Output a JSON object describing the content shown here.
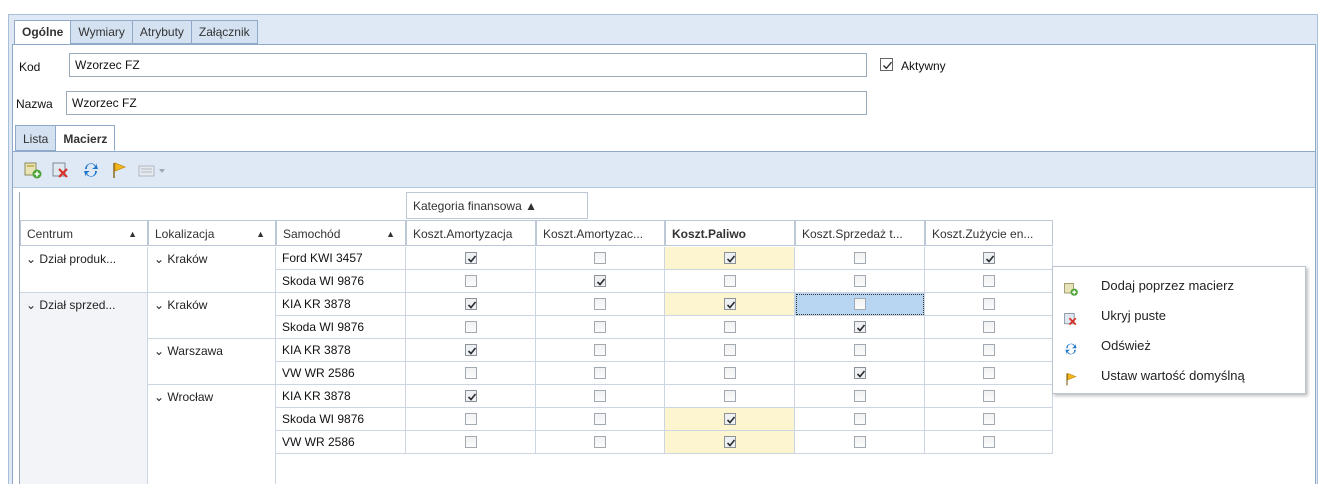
{
  "tabs": [
    {
      "label": "Ogólne",
      "active": true
    },
    {
      "label": "Wymiary"
    },
    {
      "label": "Atrybuty"
    },
    {
      "label": "Załącznik"
    }
  ],
  "form": {
    "kod_label": "Kod",
    "kod_value": "Wzorzec FZ",
    "nazwa_label": "Nazwa",
    "nazwa_value": "Wzorzec FZ",
    "aktywny_label": "Aktywny",
    "aktywny_checked": true
  },
  "subtabs": [
    {
      "label": "Lista"
    },
    {
      "label": "Macierz",
      "active": true
    }
  ],
  "toolbar": {
    "icons": [
      "add-matrix-icon",
      "hide-empty-icon",
      "refresh-icon",
      "flag-icon",
      "view-dropdown-icon"
    ]
  },
  "grid": {
    "group_header": "Kategoria finansowa",
    "row_headers": [
      "Centrum",
      "Lokalizacja",
      "Samochód"
    ],
    "columns": [
      "Koszt.Amortyzacja",
      "Koszt.Amortyzac...",
      "Koszt.Paliwo",
      "Koszt.Sprzedaż t...",
      "Koszt.Zużycie en..."
    ],
    "centrum_groups": [
      {
        "label": "Dział produk..."
      },
      {
        "label": "Dział sprzed..."
      }
    ],
    "lokalizacja_groups": [
      {
        "label": "Kraków"
      },
      {
        "label": "Kraków"
      },
      {
        "label": "Warszawa"
      },
      {
        "label": "Wrocław"
      }
    ],
    "rows": [
      {
        "samochod": "Ford KWI 3457",
        "checks": [
          true,
          false,
          true,
          false,
          true
        ]
      },
      {
        "samochod": "Skoda WI 9876",
        "checks": [
          false,
          true,
          false,
          false,
          false
        ]
      },
      {
        "samochod": "KIA KR 3878",
        "checks": [
          true,
          false,
          true,
          false,
          false
        ]
      },
      {
        "samochod": "Skoda WI 9876",
        "checks": [
          false,
          false,
          false,
          true,
          false
        ]
      },
      {
        "samochod": "KIA KR 3878",
        "checks": [
          true,
          false,
          false,
          false,
          false
        ]
      },
      {
        "samochod": "VW WR 2586",
        "checks": [
          false,
          false,
          false,
          true,
          false
        ]
      },
      {
        "samochod": "KIA KR 3878",
        "checks": [
          true,
          false,
          false,
          false,
          false
        ]
      },
      {
        "samochod": "Skoda WI 9876",
        "checks": [
          false,
          false,
          true,
          false,
          false
        ]
      },
      {
        "samochod": "VW WR 2586",
        "checks": [
          false,
          false,
          true,
          false,
          false
        ]
      }
    ]
  },
  "context_menu": {
    "items": [
      {
        "label": "Dodaj poprzez macierz",
        "icon": "add-matrix-icon"
      },
      {
        "label": "Ukryj puste",
        "icon": "hide-empty-icon"
      },
      {
        "label": "Odśwież",
        "icon": "refresh-icon"
      },
      {
        "label": "Ustaw wartość domyślną",
        "icon": "flag-icon"
      }
    ]
  },
  "colors": {
    "highlight": "#fdf5cf",
    "selection": "#b8d6f2",
    "accent": "#1e74c8",
    "frame": "#dfe9f5"
  }
}
